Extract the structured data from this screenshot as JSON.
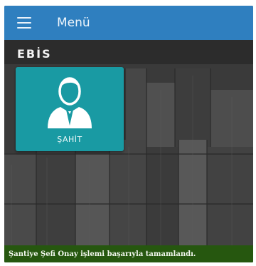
{
  "header": {
    "menu_icon": "hamburger-icon",
    "title": "Menü"
  },
  "brand": {
    "logo_text": "EBİS"
  },
  "tiles": [
    {
      "label": "ŞAHİT",
      "icon": "user-icon"
    }
  ],
  "status": {
    "message": "Şantiye Şefi Onay işlemi başarıyla tamamlandı."
  },
  "colors": {
    "header_bg": "#2f7fbf",
    "tile_bg": "#199aa3",
    "status_bg": "#26570f"
  }
}
